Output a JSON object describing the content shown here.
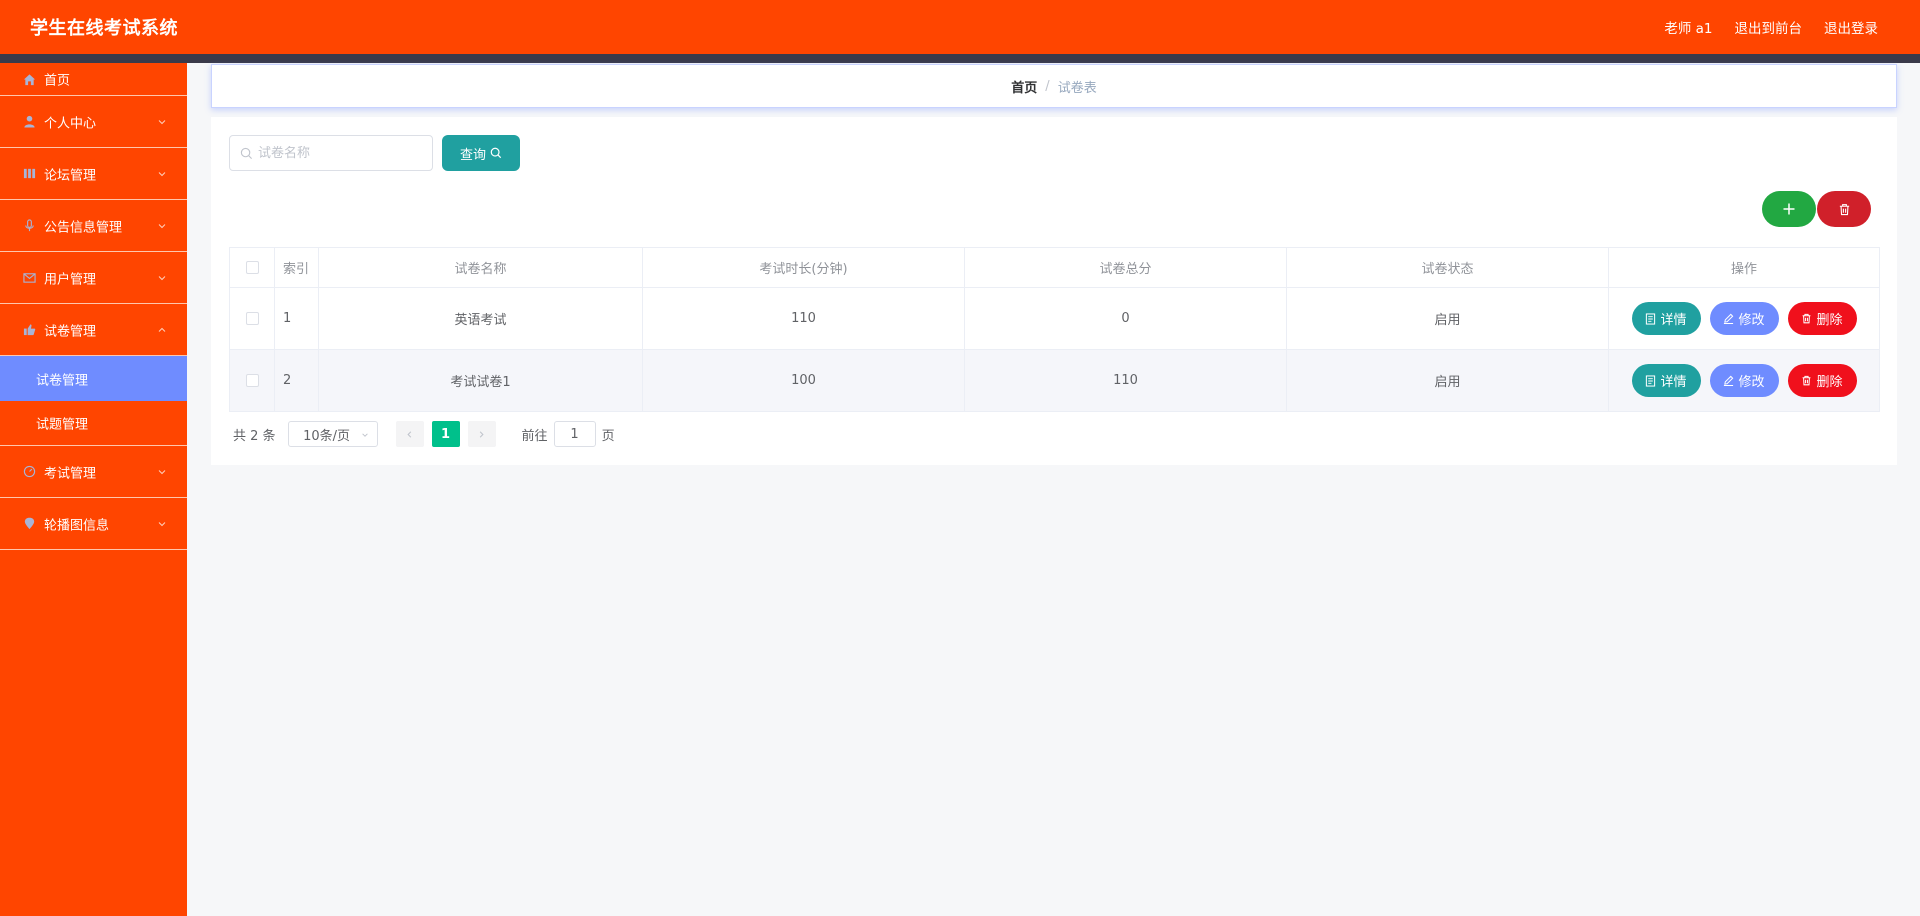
{
  "app": {
    "title": "学生在线考试系统"
  },
  "header": {
    "user": "老师 a1",
    "front_link": "退出到前台",
    "logout": "退出登录"
  },
  "sidebar": {
    "items": [
      {
        "label": "首页",
        "icon": "home-icon"
      },
      {
        "label": "个人中心",
        "icon": "user-icon"
      },
      {
        "label": "论坛管理",
        "icon": "forum-icon"
      },
      {
        "label": "公告信息管理",
        "icon": "microphone-icon"
      },
      {
        "label": "用户管理",
        "icon": "mail-icon"
      },
      {
        "label": "试卷管理",
        "icon": "thumb-icon",
        "expanded": true,
        "children": [
          {
            "label": "试卷管理",
            "active": true
          },
          {
            "label": "试题管理"
          }
        ]
      },
      {
        "label": "考试管理",
        "icon": "odometer-icon"
      },
      {
        "label": "轮播图信息",
        "icon": "location-icon"
      }
    ]
  },
  "breadcrumb": {
    "home": "首页",
    "separator": "/",
    "current": "试卷表"
  },
  "search": {
    "placeholder": "试卷名称",
    "value": "",
    "button": "查询"
  },
  "table": {
    "columns": [
      "索引",
      "试卷名称",
      "考试时长(分钟)",
      "试卷总分",
      "试卷状态",
      "操作"
    ],
    "rows": [
      {
        "index": "1",
        "name": "英语考试",
        "duration": "110",
        "score": "0",
        "status": "启用"
      },
      {
        "index": "2",
        "name": "考试试卷1",
        "duration": "100",
        "score": "110",
        "status": "启用"
      }
    ],
    "actions": {
      "detail": "详情",
      "edit": "修改",
      "delete": "删除"
    }
  },
  "pagination": {
    "total": "共 2 条",
    "page_size": "10条/页",
    "current_page": "1",
    "goto_prefix": "前往",
    "goto_value": "1",
    "goto_suffix": "页"
  },
  "colors": {
    "brand": "#ff4500",
    "active_menu": "#6f8cff",
    "teal": "#20a0a0",
    "success": "#22a842",
    "danger": "#d0202a",
    "pager_active": "#00c08b"
  }
}
